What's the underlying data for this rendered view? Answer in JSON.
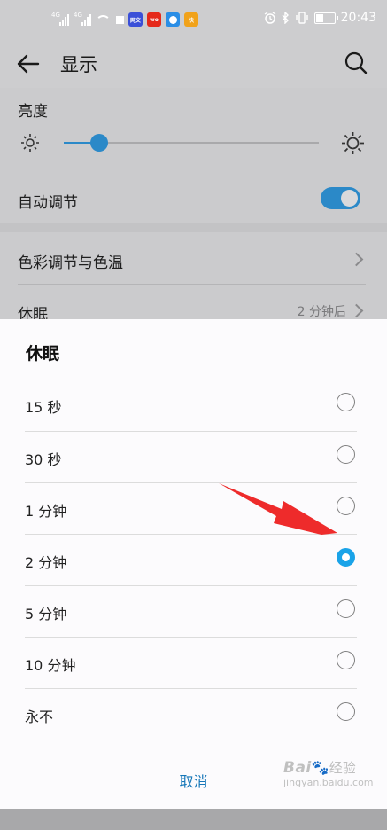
{
  "status_bar": {
    "signal1_tag": "4G",
    "signal2_tag": "4G",
    "app_icons": [
      {
        "icon": "blue-app-icon",
        "text": "网文",
        "color": "#3a4fd8"
      },
      {
        "icon": "red-app-icon",
        "text": "wo",
        "color": "#e5291a"
      },
      {
        "icon": "blue-round-app-icon",
        "text": "",
        "color": "#2a8ee6"
      },
      {
        "icon": "orange-app-icon",
        "text": "快",
        "color": "#f1a21a"
      }
    ],
    "time": "20:43"
  },
  "header": {
    "title": "显示"
  },
  "brightness": {
    "label": "亮度",
    "level_percent": 14
  },
  "auto_adjust": {
    "label": "自动调节",
    "on": true
  },
  "color": {
    "label": "色彩调节与色温"
  },
  "sleep": {
    "label": "休眠",
    "value": "2 分钟后"
  },
  "dialog": {
    "title": "休眠",
    "options": [
      "15 秒",
      "30 秒",
      "1 分钟",
      "2 分钟",
      "5 分钟",
      "10 分钟",
      "永不"
    ],
    "selected_index": 3,
    "cancel": "取消"
  },
  "watermark": {
    "brand": "Bai",
    "brand2": "经验",
    "url": "jingyan.baidu.com"
  },
  "accent_color": "#2b89c8",
  "radio_selected_color": "#1aa3e8"
}
